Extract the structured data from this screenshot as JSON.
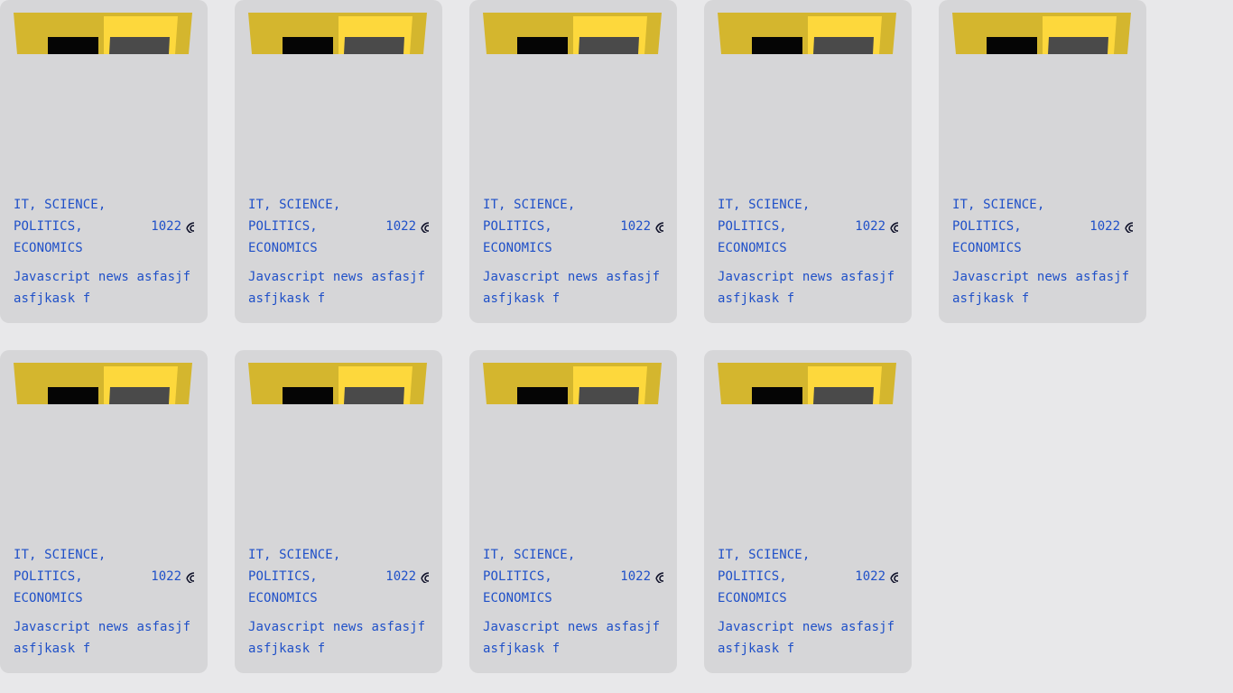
{
  "cards": [
    {
      "categories": "IT, SCIENCE, POLITICS, ECONOMICS",
      "views": "1022",
      "title": "Javascript news asfasjf asfjkask f"
    },
    {
      "categories": "IT, SCIENCE, POLITICS, ECONOMICS",
      "views": "1022",
      "title": "Javascript news asfasjf asfjkask f"
    },
    {
      "categories": "IT, SCIENCE, POLITICS, ECONOMICS",
      "views": "1022",
      "title": "Javascript news asfasjf asfjkask f"
    },
    {
      "categories": "IT, SCIENCE, POLITICS, ECONOMICS",
      "views": "1022",
      "title": "Javascript news asfasjf asfjkask f"
    },
    {
      "categories": "IT, SCIENCE, POLITICS, ECONOMICS",
      "views": "1022",
      "title": "Javascript news asfasjf asfjkask f"
    },
    {
      "categories": "IT, SCIENCE, POLITICS, ECONOMICS",
      "views": "1022",
      "title": "Javascript news asfasjf asfjkask f"
    },
    {
      "categories": "IT, SCIENCE, POLITICS, ECONOMICS",
      "views": "1022",
      "title": "Javascript news asfasjf asfjkask f"
    },
    {
      "categories": "IT, SCIENCE, POLITICS, ECONOMICS",
      "views": "1022",
      "title": "Javascript news asfasjf asfjkask f"
    },
    {
      "categories": "IT, SCIENCE, POLITICS, ECONOMICS",
      "views": "1022",
      "title": "Javascript news asfasjf asfjkask f"
    }
  ],
  "icons": {
    "views": "eye-icon"
  },
  "colors": {
    "page_background": "#e8e8ea",
    "card_background": "#d6d6d8",
    "text_accent": "#1f50c8",
    "thumb_yellow_dark": "#d4b62e",
    "thumb_yellow_light": "#fdd83c",
    "thumb_black": "#050505",
    "thumb_gray": "#4a4a4a"
  }
}
